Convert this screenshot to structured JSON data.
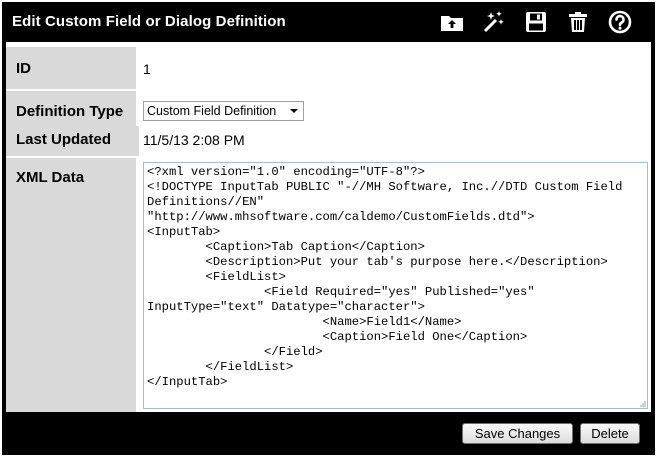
{
  "dialog": {
    "title": "Edit Custom Field or Dialog Definition",
    "toolbar": [
      {
        "icon": "folder-upload-icon",
        "action": "open"
      },
      {
        "icon": "magic-wand-icon",
        "action": "wizard"
      },
      {
        "icon": "floppy-disk-icon",
        "action": "save"
      },
      {
        "icon": "trash-icon",
        "action": "delete"
      },
      {
        "icon": "help-icon",
        "action": "help"
      }
    ]
  },
  "fields": {
    "id": {
      "label": "ID",
      "value": "1"
    },
    "definition_type": {
      "label": "Definition Type",
      "selected": "Custom Field Definition"
    },
    "last_updated": {
      "label": "Last Updated",
      "value": "11/5/13 2:08 PM"
    },
    "xml_data": {
      "label": "XML Data",
      "value": "<?xml version=\"1.0\" encoding=\"UTF-8\"?>\n<!DOCTYPE InputTab PUBLIC \"-//MH Software, Inc.//DTD Custom Field Definitions//EN\" \"http://www.mhsoftware.com/caldemo/CustomFields.dtd\">\n<InputTab>\n        <Caption>Tab Caption</Caption>\n        <Description>Put your tab's purpose here.</Description>\n        <FieldList>\n                <Field Required=\"yes\" Published=\"yes\" InputType=\"text\" Datatype=\"character\">\n                        <Name>Field1</Name>\n                        <Caption>Field One</Caption>\n                </Field>\n        </FieldList>\n</InputTab>"
    }
  },
  "footer": {
    "save_label": "Save Changes",
    "delete_label": "Delete"
  },
  "colors": {
    "frame": "#000000",
    "label_bg": "#d9d9d9",
    "textarea_border": "#a8bcd0"
  }
}
